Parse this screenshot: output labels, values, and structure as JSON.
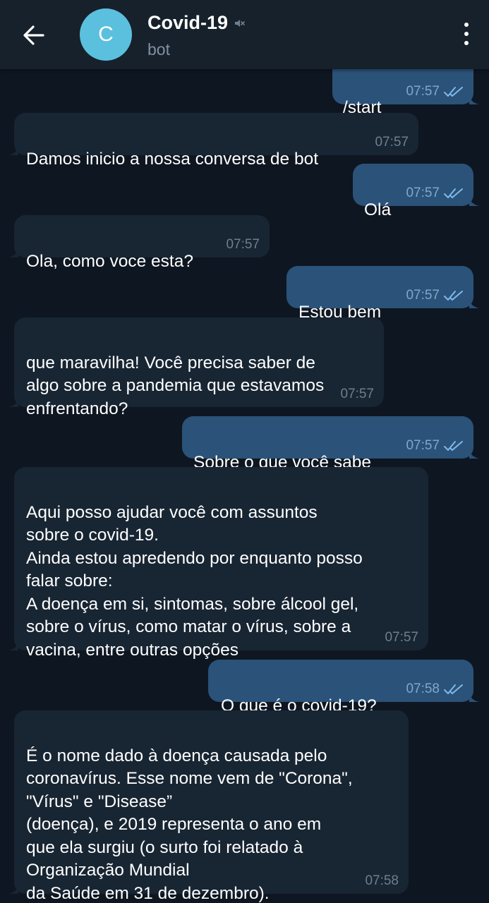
{
  "colors": {
    "background": "#0e1621",
    "header": "#17212b",
    "incoming_bubble": "#182533",
    "outgoing_bubble": "#2b5278",
    "avatar": "#5bc0de",
    "check_marks": "#7fb9eb"
  },
  "header": {
    "back_icon": "arrow-left-icon",
    "avatar_letter": "C",
    "title": "Covid-19",
    "muted_icon": "muted-speaker-icon",
    "subtitle": "bot",
    "menu_icon": "more-vertical-icon"
  },
  "messages": [
    {
      "direction": "out",
      "text": "/start",
      "time": "07:57",
      "read": true
    },
    {
      "direction": "in",
      "text": "Damos inicio a nossa conversa de bot",
      "time": "07:57"
    },
    {
      "direction": "out",
      "text": "Olá",
      "time": "07:57",
      "read": true
    },
    {
      "direction": "in",
      "text": "Ola, como voce esta?",
      "time": "07:57"
    },
    {
      "direction": "out",
      "text": "Estou bem",
      "time": "07:57",
      "read": true
    },
    {
      "direction": "in",
      "text": "que maravilha! Você precisa saber de\nalgo sobre a pandemia que estavamos\nenfrentando?",
      "time": "07:57"
    },
    {
      "direction": "out",
      "text": "Sobre o que você sabe",
      "time": "07:57",
      "read": true
    },
    {
      "direction": "in",
      "text": "Aqui posso ajudar você com assuntos\nsobre o covid-19.\nAinda estou apredendo por enquanto posso\nfalar sobre:\nA doença em si, sintomas, sobre álcool gel,\nsobre o vírus, como matar o vírus, sobre a\nvacina, entre outras opções",
      "time": "07:57"
    },
    {
      "direction": "out",
      "text": "O que é o covid-19?",
      "time": "07:58",
      "read": true
    },
    {
      "direction": "in",
      "text": "É o nome dado à doença causada pelo\ncoronavírus. Esse nome vem de \"Corona\",\n\"Vírus\" e \"Disease”\n(doença), e 2019 representa o ano em\nque ela surgiu (o surto foi relatado à\nOrganização Mundial\nda Saúde em 31 de dezembro).",
      "time": "07:58"
    }
  ]
}
